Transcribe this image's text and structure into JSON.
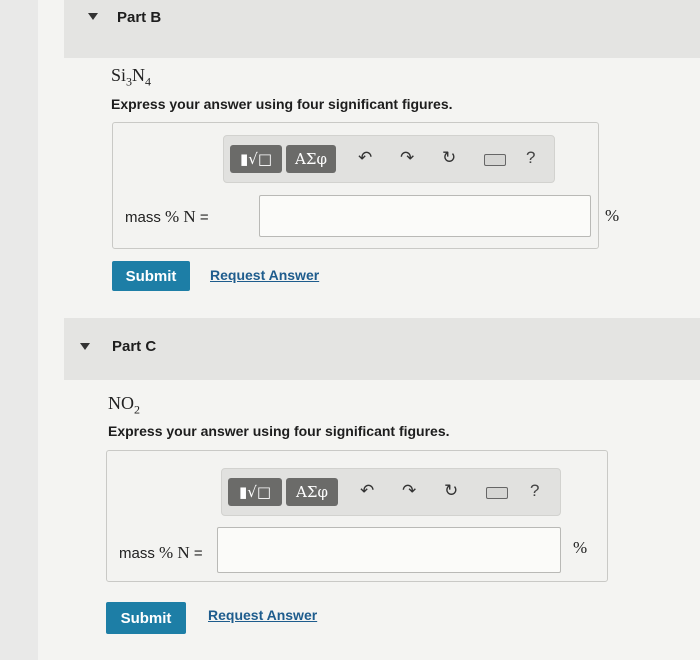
{
  "parts": [
    {
      "title": "Part B",
      "formula_main": "Si",
      "formula_sub1": "3",
      "formula_mid": "N",
      "formula_sub2": "4",
      "prompt": "Express your answer using four significant figures.",
      "toolbar": {
        "templates": "▮√□",
        "symbols": "ΑΣφ",
        "help": "?"
      },
      "answer_label_prefix": "mass",
      "answer_label_symbol": "% N",
      "answer_label_eq": "=",
      "answer_value": "",
      "unit": "%",
      "submit_label": "Submit",
      "request_label": "Request Answer"
    },
    {
      "title": "Part C",
      "formula_main": "NO",
      "formula_sub1": "2",
      "formula_mid": "",
      "formula_sub2": "",
      "prompt": "Express your answer using four significant figures.",
      "toolbar": {
        "templates": "▮√□",
        "symbols": "ΑΣφ",
        "help": "?"
      },
      "answer_label_prefix": "mass",
      "answer_label_symbol": "% N",
      "answer_label_eq": "=",
      "answer_value": "",
      "unit": "%",
      "submit_label": "Submit",
      "request_label": "Request Answer"
    }
  ],
  "icons": {
    "undo": "undo-icon",
    "redo": "redo-icon",
    "reset": "reset-icon",
    "keyboard": "keyboard-icon"
  },
  "colors": {
    "submit": "#1d7ea6",
    "link": "#1e5c8d",
    "toolbar_button": "#6b6b69"
  }
}
